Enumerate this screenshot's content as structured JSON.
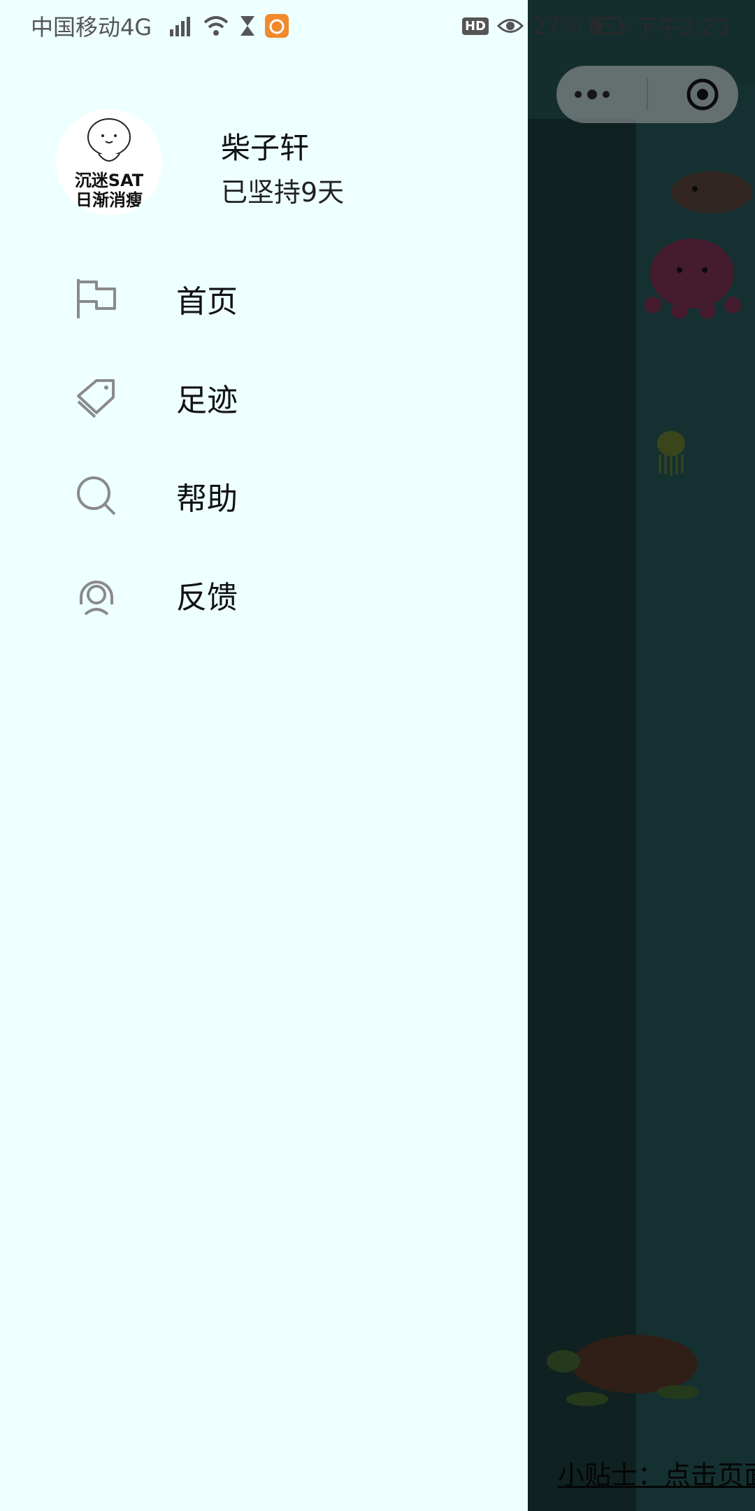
{
  "status_bar": {
    "carrier": "中国移动4G",
    "network_badge": "4G",
    "hd_badge": "HD",
    "battery_percent": "27%",
    "time": "下午3:23"
  },
  "profile": {
    "avatar_line1": "沉迷SAT",
    "avatar_line2": "日渐消瘦",
    "username": "柴子轩",
    "streak": "已坚持9天"
  },
  "menu": {
    "items": [
      {
        "label": "首页",
        "icon": "flag-icon"
      },
      {
        "label": "足迹",
        "icon": "tag-icon"
      },
      {
        "label": "帮助",
        "icon": "search-icon"
      },
      {
        "label": "反馈",
        "icon": "headset-icon"
      }
    ]
  },
  "background_app": {
    "tip_text": "小贴士：点击页面"
  },
  "colors": {
    "drawer_bg": "#eeffff",
    "ocean_bg": "#1f4646",
    "icon_gray": "#8a8a8a"
  }
}
